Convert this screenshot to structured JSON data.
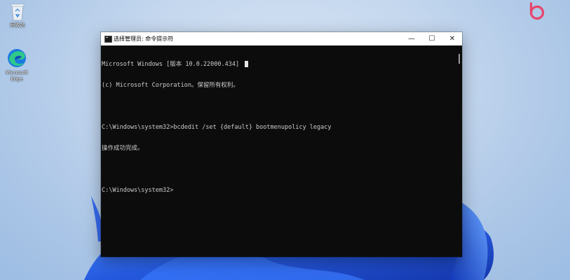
{
  "desktop": {
    "icons": [
      {
        "label": "回收站",
        "icon": "recycle-bin-icon"
      },
      {
        "label": "Microsoft Edge",
        "icon": "edge-icon"
      }
    ],
    "corner_logo": "brand-logo-icon",
    "wallpaper": "windows-11-bloom"
  },
  "window": {
    "title": "选择管理员: 命令提示符",
    "controls": {
      "minimize": "—",
      "maximize": "☐",
      "close": "✕"
    },
    "console_lines": [
      "Microsoft Windows [版本 10.0.22000.434]",
      "(c) Microsoft Corporation。保留所有权利。",
      "",
      "C:\\Windows\\system32>bcdedit /set {default} bootmenupolicy legacy",
      "操作成功完成。",
      "",
      "C:\\Windows\\system32>"
    ]
  },
  "colors": {
    "console_bg": "#0c0c0c",
    "console_text": "#cccccc",
    "bloom_blue": "#1a4fd6",
    "logo_pink": "#e8436a"
  }
}
